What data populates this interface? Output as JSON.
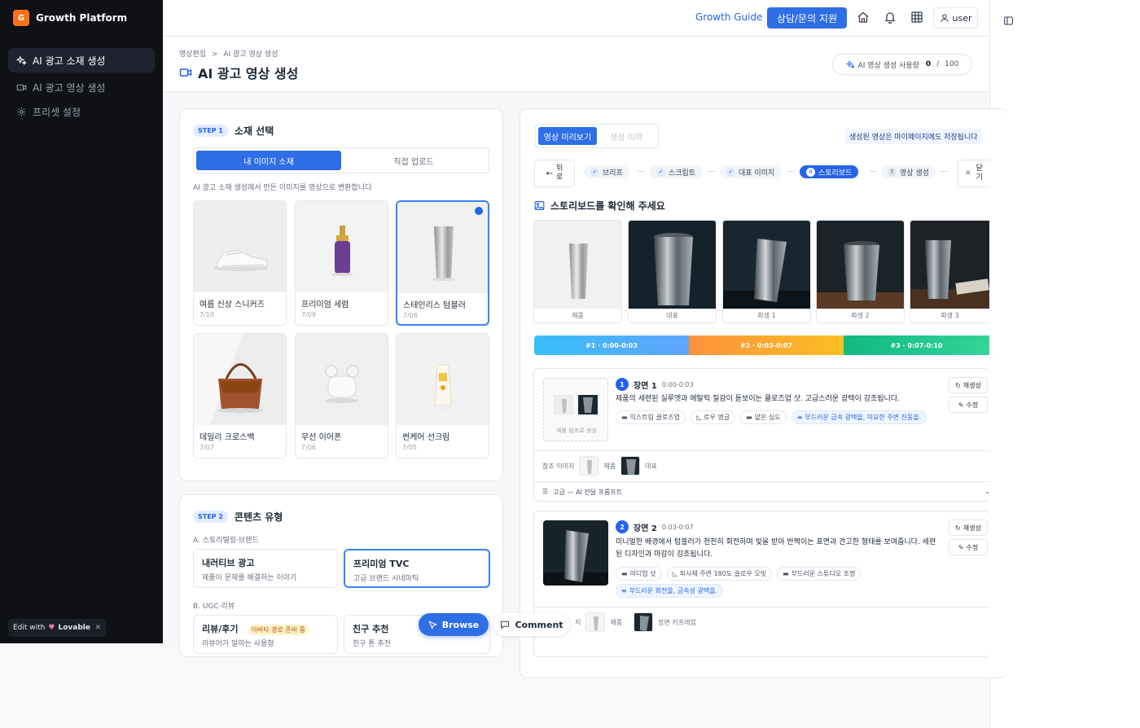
{
  "sidebar": {
    "brand_logo": "G",
    "brand_name": "Growth Platform",
    "items": [
      {
        "label": "AI 광고 소재 생성",
        "icon": "sparkles-icon",
        "active": true
      },
      {
        "label": "AI 광고 영상 생성",
        "icon": "video-icon",
        "active": false
      },
      {
        "label": "프리셋 설정",
        "icon": "gear-icon",
        "active": false
      }
    ],
    "edit_with": "Edit with",
    "lovable": "Lovable"
  },
  "topbar": {
    "guide": "Growth Guide",
    "support": "상담/문의 지원",
    "user": "user"
  },
  "header": {
    "breadcrumb_1": "영상편집",
    "breadcrumb_sep": ">",
    "breadcrumb_2": "AI 광고 영상 생성",
    "title": "AI 광고 영상 생성",
    "usage_label": "AI 영상 생성 사용량",
    "usage_used": "0",
    "usage_sep": "/",
    "usage_total": "100"
  },
  "step1": {
    "badge": "STEP 1",
    "title": "소재 선택",
    "tab_mine": "내 이미지 소재",
    "tab_upload": "직접 업로드",
    "hint": "AI 광고 소재 생성에서 만든 이미지를 영상으로 변환합니다",
    "items": [
      {
        "name": "여름 신상 스니커즈",
        "date": "7/10"
      },
      {
        "name": "프리미엄 세럼",
        "date": "7/09"
      },
      {
        "name": "스테인리스 텀블러",
        "date": "7/08"
      },
      {
        "name": "데일리 크로스백",
        "date": "7/07"
      },
      {
        "name": "무선 이어폰",
        "date": "7/06"
      },
      {
        "name": "썬케어 선크림",
        "date": "7/05"
      }
    ]
  },
  "step2": {
    "badge": "STEP 2",
    "title": "콘텐츠 유형",
    "group_a": "A. 스토리텔링·브랜드",
    "opt1_title": "내러티브 광고",
    "opt1_sub": "제품이 문제를 해결하는 이야기",
    "opt2_title": "프리미엄 TVC",
    "opt2_sub": "고급 브랜드 시네마틱",
    "group_b": "B. UGC·리뷰",
    "opt3_title": "리뷰/후기",
    "opt3_tag": "아바타 경로 준비 중",
    "opt3_sub": "리뷰어가 말하는 사용형",
    "opt4_title": "친구 추천",
    "opt4_sub": "친구 톤 추천"
  },
  "floating": {
    "browse": "Browse",
    "comment": "Comment"
  },
  "preview": {
    "tab_preview": "영상 미리보기",
    "tab_history": "생성 이력",
    "saved_note": "생성된 영상은 마이페이지에도 저장됩니다",
    "back_1": "뒤",
    "back_2": "로",
    "close_1": "닫",
    "close_2": "기",
    "steps": [
      {
        "label": "브리프",
        "mark": "✓",
        "state": "done"
      },
      {
        "label": "스크립트",
        "mark": "✓",
        "state": "done"
      },
      {
        "label": "대표 이미지",
        "mark": "✓",
        "state": "done"
      },
      {
        "label": "스토리보드",
        "mark": "4",
        "state": "active"
      },
      {
        "label": "영상 생성",
        "mark": "5",
        "state": "todo"
      }
    ],
    "section_title": "스토리보드를 확인해 주세요",
    "frames": [
      "제품",
      "대표",
      "파생 1",
      "파생 2",
      "파생 3"
    ],
    "timeline": [
      "#1 · 0:00-0:03",
      "#2 · 0:03-0:07",
      "#3 · 0:07-0:10"
    ],
    "scenes": [
      {
        "num": "1",
        "title": "장면 1",
        "time": "0:00-0:03",
        "ref_caption": "제품 참조로 생성",
        "desc": "제품의 세련된 실루엣과 메탈릭 질감이 돋보이는 클로즈업 샷. 고급스러운 광택이 강조됩니다.",
        "chips": [
          "익스트림 클로즈업",
          "로우 앵글",
          "얕은 심도",
          "부드러운 금속 광택을, 미묘한 주변 진동을."
        ],
        "regen": "재생성",
        "edit": "수정",
        "ref_label": "참조 이미지",
        "ref1": "제품",
        "ref2": "대표",
        "prompt": "고급 — AI 전달 프롬프트"
      },
      {
        "num": "2",
        "title": "장면 2",
        "time": "0:03-0:07",
        "desc": "미니멀한 배경에서 텀블러가 천천히 회전하며 빛을 받아 반짝이는 표면과 견고한 형태를 보여줍니다. 세련된 디자인과 마감이 강조됩니다.",
        "chips": [
          "미디엄 샷",
          "피사체 주변 180도 슬로우 오빗",
          "부드러운 스튜디오 조명",
          "부드러운 회전을, 금속성 광택을."
        ],
        "regen": "재생성",
        "edit": "수정",
        "ref_label": "지",
        "ref1": "제품",
        "ref2": "장면 키프레임"
      }
    ]
  },
  "colors": {
    "primary": "#2e6ee6",
    "sidebar_bg": "#0f1117",
    "timeline_1": "#38bdf8",
    "timeline_2": "#fb923c",
    "timeline_3": "#34d399"
  }
}
